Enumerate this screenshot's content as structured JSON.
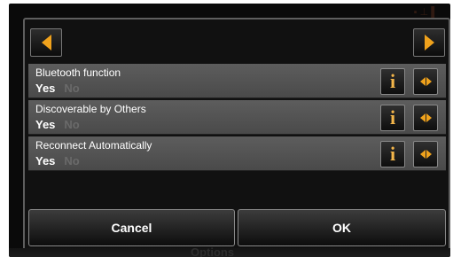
{
  "settings": [
    {
      "label": "Bluetooth function",
      "selected": "Yes",
      "other": "No"
    },
    {
      "label": "Discoverable by Others",
      "selected": "Yes",
      "other": "No"
    },
    {
      "label": "Reconnect Automatically",
      "selected": "Yes",
      "other": "No"
    }
  ],
  "footer": {
    "cancel_label": "Cancel",
    "ok_label": "OK"
  },
  "background": {
    "options_label": "Options"
  },
  "icons": {
    "prev": "arrow-left-icon",
    "next": "arrow-right-icon",
    "info": "info-icon",
    "toggle": "toggle-arrows-icon"
  },
  "colors": {
    "accent": "#f0a21c",
    "row_bg": "#555555",
    "dialog_bg": "#111111"
  }
}
